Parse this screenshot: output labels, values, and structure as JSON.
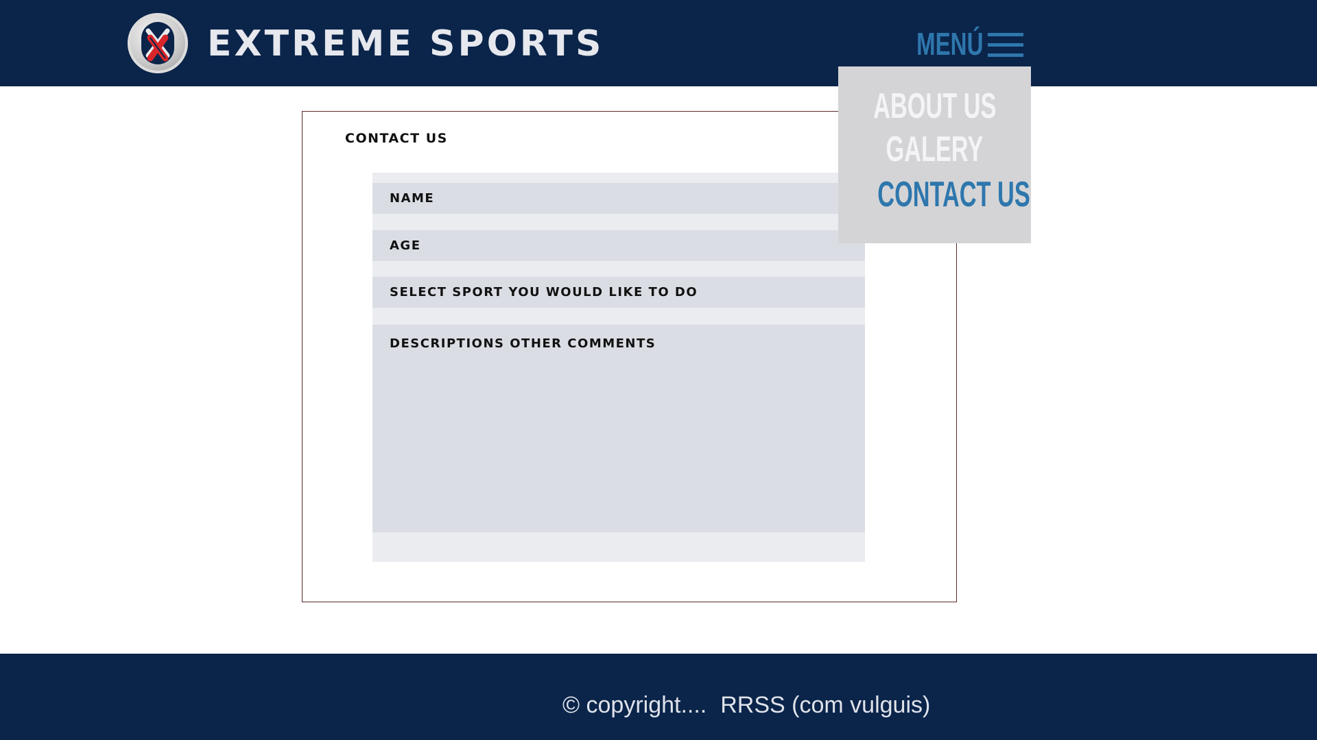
{
  "header": {
    "site_title": "EXTREME SPORTS",
    "logo_icon": "x-logo-icon",
    "menu_label": "MENÚ",
    "menu_icon": "hamburger-icon"
  },
  "dropdown": {
    "items": [
      {
        "label": "ABOUT US",
        "active": false
      },
      {
        "label": "GALERY",
        "active": false
      },
      {
        "label": "CONTACT US",
        "active": true
      }
    ]
  },
  "contact": {
    "title": "CONTACT US",
    "fields": {
      "name": "NAME",
      "age": "AGE",
      "sport": "SELECT SPORT YOU WOULD LIKE TO DO",
      "description": "DESCRIPTIONS OTHER COMMENTS"
    }
  },
  "footer": {
    "copyright": "© copyright....",
    "social": "RRSS (com vulguis)"
  },
  "colors": {
    "navy": "#0b244a",
    "accent_blue": "#2e77ad",
    "menu_text_inactive": "#f4f4f6",
    "dropdown_bg": "#d4d4d6",
    "field_bg": "#dadde4",
    "panel_bg": "#ebecf0"
  }
}
